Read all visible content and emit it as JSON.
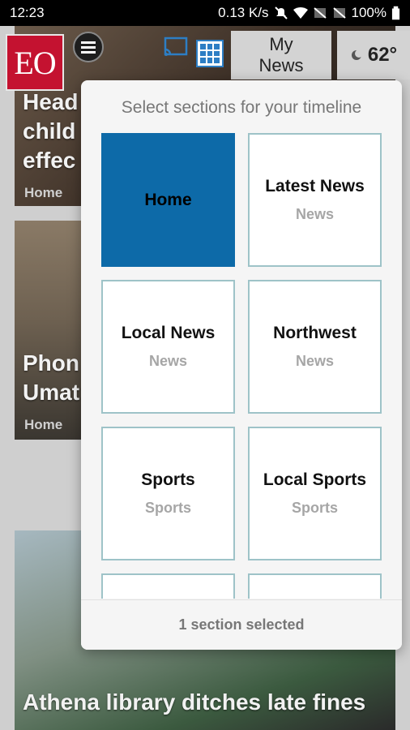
{
  "status_bar": {
    "time": "12:23",
    "net_speed": "0.13 K/s",
    "battery": "100%"
  },
  "header": {
    "logo_text": "EO",
    "my_news_line1": "My",
    "my_news_line2": "News",
    "temperature": "62°"
  },
  "feed": {
    "stories": [
      {
        "headline_lines": [
          "Head",
          "child",
          "effec"
        ],
        "meta": "Home"
      },
      {
        "headline_lines": [
          "Phon",
          "Umat"
        ],
        "meta": "Home"
      },
      {
        "headline_lines": [
          "Athena library ditches late fines"
        ],
        "meta": ""
      }
    ]
  },
  "modal": {
    "title": "Select sections for your timeline",
    "tiles": [
      {
        "title": "Home",
        "subtitle": "",
        "selected": true
      },
      {
        "title": "Latest News",
        "subtitle": "News",
        "selected": false
      },
      {
        "title": "Local News",
        "subtitle": "News",
        "selected": false
      },
      {
        "title": "Northwest",
        "subtitle": "News",
        "selected": false
      },
      {
        "title": "Sports",
        "subtitle": "Sports",
        "selected": false
      },
      {
        "title": "Local Sports",
        "subtitle": "Sports",
        "selected": false
      }
    ],
    "footer": "1 section selected"
  },
  "colors": {
    "accent": "#0d6aa8",
    "brand": "#c41230",
    "tile_border": "#9ec3c8"
  }
}
